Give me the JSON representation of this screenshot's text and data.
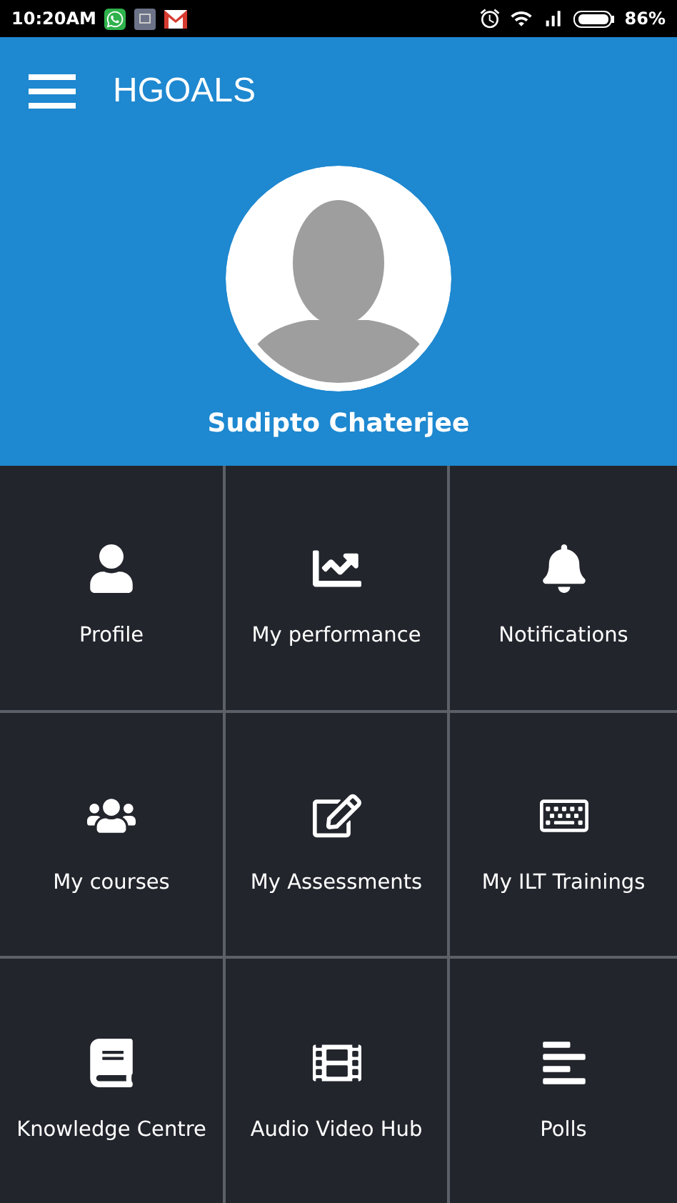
{
  "status_bar": {
    "time": "10:20AM",
    "battery": "86%"
  },
  "app_bar": {
    "title": "HGOALS"
  },
  "profile": {
    "name": "Sudipto Chaterjee"
  },
  "tiles": [
    {
      "label": "Profile"
    },
    {
      "label": "My performance"
    },
    {
      "label": "Notifications"
    },
    {
      "label": "My courses"
    },
    {
      "label": "My Assessments"
    },
    {
      "label": "My ILT Trainings"
    },
    {
      "label": "Knowledge Centre"
    },
    {
      "label": "Audio Video Hub"
    },
    {
      "label": "Polls"
    }
  ]
}
